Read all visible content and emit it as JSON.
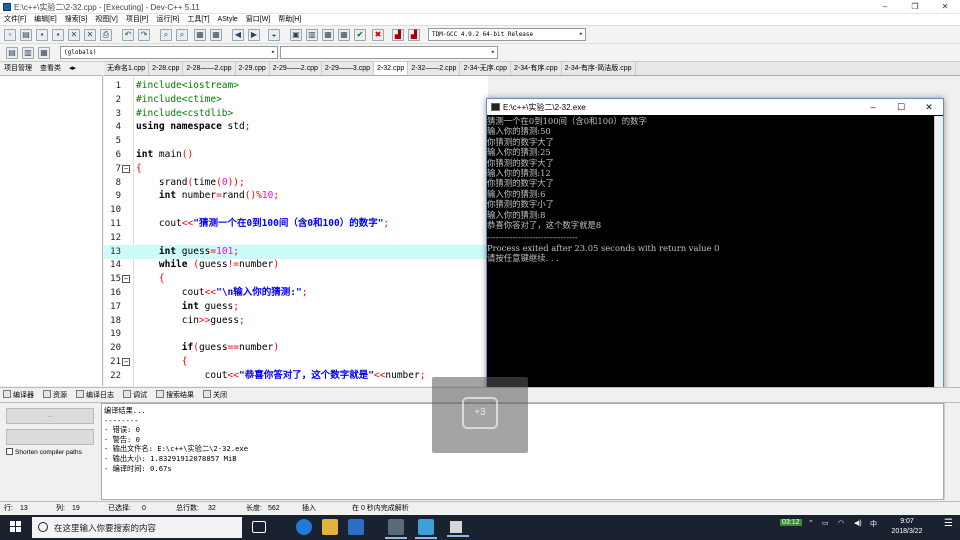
{
  "window": {
    "title": "E:\\c++\\实验二\\2-32.cpp - [Executing] - Dev-C++ 5.11",
    "minimize": "–",
    "restore": "❐",
    "close": "✕"
  },
  "menu": [
    "文件[F]",
    "编辑[E]",
    "搜索[S]",
    "视图[V]",
    "项目[P]",
    "运行[R]",
    "工具[T]",
    "AStyle",
    "窗口[W]",
    "帮助[H]"
  ],
  "toolbar": {
    "compiler": "TDM-GCC 4.9.2 64-bit Release",
    "scope": "(globals)"
  },
  "left_tabs": [
    "项目管理",
    "查看类"
  ],
  "file_tabs": [
    "无命名1.cpp",
    "2-28.cpp",
    "2-28——2.cpp",
    "2-29.cpp",
    "2-29——2.cpp",
    "2-29——3.cpp",
    "2-32.cpp",
    "2-32——2.cpp",
    "2-34-无序.cpp",
    "2-34-有序.cpp",
    "2-34-有序-简洁版.cpp"
  ],
  "active_file_tab": 6,
  "editor": {
    "highlight_line": 13,
    "lines": [
      {
        "n": "1",
        "fold": "",
        "parts": [
          [
            "pp",
            "#include<iostream>"
          ]
        ]
      },
      {
        "n": "2",
        "fold": "",
        "parts": [
          [
            "pp",
            "#include<ctime>"
          ]
        ]
      },
      {
        "n": "3",
        "fold": "",
        "parts": [
          [
            "pp",
            "#include<cstdlib>"
          ]
        ]
      },
      {
        "n": "4",
        "fold": "",
        "parts": [
          [
            "kw",
            "using namespace"
          ],
          [
            "plain",
            " std"
          ],
          [
            "sym",
            ";"
          ]
        ]
      },
      {
        "n": "5",
        "fold": "",
        "parts": []
      },
      {
        "n": "6",
        "fold": "",
        "parts": [
          [
            "kw",
            "int"
          ],
          [
            "plain",
            " main"
          ],
          [
            "sym",
            "()"
          ]
        ]
      },
      {
        "n": "7",
        "fold": "−",
        "parts": [
          [
            "sym",
            "{"
          ]
        ]
      },
      {
        "n": "8",
        "fold": "",
        "parts": [
          [
            "plain",
            "    srand"
          ],
          [
            "sym",
            "("
          ],
          [
            "plain",
            "time"
          ],
          [
            "sym",
            "("
          ],
          [
            "num",
            "0"
          ],
          [
            "sym",
            "));"
          ]
        ]
      },
      {
        "n": "9",
        "fold": "",
        "parts": [
          [
            "plain",
            "    "
          ],
          [
            "kw",
            "int"
          ],
          [
            "plain",
            " number"
          ],
          [
            "sym",
            "="
          ],
          [
            "plain",
            "rand"
          ],
          [
            "sym",
            "()%"
          ],
          [
            "num",
            "10"
          ],
          [
            "sym",
            ";"
          ]
        ]
      },
      {
        "n": "10",
        "fold": "",
        "parts": []
      },
      {
        "n": "11",
        "fold": "",
        "parts": [
          [
            "plain",
            "    cout"
          ],
          [
            "sym",
            "<<"
          ],
          [
            "str",
            "\"猜测一个在0到100间（含0和100）的数字\""
          ],
          [
            "sym",
            ";"
          ]
        ]
      },
      {
        "n": "12",
        "fold": "",
        "parts": []
      },
      {
        "n": "13",
        "fold": "",
        "parts": [
          [
            "plain",
            "    "
          ],
          [
            "kw",
            "int"
          ],
          [
            "plain",
            " guess"
          ],
          [
            "sym",
            "="
          ],
          [
            "num",
            "101"
          ],
          [
            "sym",
            ";"
          ]
        ]
      },
      {
        "n": "14",
        "fold": "",
        "parts": [
          [
            "plain",
            "    "
          ],
          [
            "kw",
            "while"
          ],
          [
            "plain",
            " "
          ],
          [
            "sym",
            "("
          ],
          [
            "plain",
            "guess"
          ],
          [
            "sym",
            "!="
          ],
          [
            "plain",
            "number"
          ],
          [
            "sym",
            ")"
          ]
        ]
      },
      {
        "n": "15",
        "fold": "−",
        "parts": [
          [
            "plain",
            "    "
          ],
          [
            "sym",
            "{"
          ]
        ]
      },
      {
        "n": "16",
        "fold": "",
        "parts": [
          [
            "plain",
            "        cout"
          ],
          [
            "sym",
            "<<"
          ],
          [
            "str",
            "\"\\n输入你的猜测:\""
          ],
          [
            "sym",
            ";"
          ]
        ]
      },
      {
        "n": "17",
        "fold": "",
        "parts": [
          [
            "plain",
            "        "
          ],
          [
            "kw",
            "int"
          ],
          [
            "plain",
            " guess"
          ],
          [
            "sym",
            ";"
          ]
        ]
      },
      {
        "n": "18",
        "fold": "",
        "parts": [
          [
            "plain",
            "        cin"
          ],
          [
            "sym",
            ">>"
          ],
          [
            "plain",
            "guess"
          ],
          [
            "sym",
            ";"
          ]
        ]
      },
      {
        "n": "19",
        "fold": "",
        "parts": []
      },
      {
        "n": "20",
        "fold": "",
        "parts": [
          [
            "plain",
            "        "
          ],
          [
            "kw",
            "if"
          ],
          [
            "sym",
            "("
          ],
          [
            "plain",
            "guess"
          ],
          [
            "sym",
            "=="
          ],
          [
            "plain",
            "number"
          ],
          [
            "sym",
            ")"
          ]
        ]
      },
      {
        "n": "21",
        "fold": "−",
        "parts": [
          [
            "plain",
            "        "
          ],
          [
            "sym",
            "{"
          ]
        ]
      },
      {
        "n": "22",
        "fold": "",
        "parts": [
          [
            "plain",
            "            cout"
          ],
          [
            "sym",
            "<<"
          ],
          [
            "str",
            "\"恭喜你答对了，这个数字就是\""
          ],
          [
            "sym",
            "<<"
          ],
          [
            "plain",
            "number"
          ],
          [
            "sym",
            ";"
          ]
        ]
      }
    ]
  },
  "console": {
    "title": "E:\\c++\\实验二\\2-32.exe",
    "lines": [
      "猜测一个在0到100间（含0和100）的数字",
      "输入你的猜测:50",
      "你猜测的数字大了",
      "输入你的猜测:25",
      "你猜测的数字大了",
      "输入你的猜测:12",
      "你猜测的数字大了",
      "输入你的猜测:6",
      "你猜测的数字小了",
      "输入你的猜测:8",
      "恭喜你答对了，这个数字就是8",
      "--------------------------------",
      "Process exited after 23.05 seconds with return value 0",
      "请按任意键继续. . ."
    ]
  },
  "bottom_tabs": [
    "编译器",
    "资源",
    "编译日志",
    "调试",
    "搜索结果",
    "关闭"
  ],
  "bottom_left": {
    "button1": "...",
    "button2": "",
    "shorten": "Shorten compiler paths"
  },
  "log": [
    "编译结果...",
    "--------",
    "- 错误: 0",
    "- 警告: 0",
    "- 输出文件名: E:\\c++\\实验二\\2-32.exe",
    "- 输出大小: 1.83291912078857 MiB",
    "- 编译时间: 0.67s"
  ],
  "status": {
    "row_label": "行:",
    "row": "13",
    "col_label": "列:",
    "col": "19",
    "sel_label": "已选择:",
    "sel": "0",
    "total_label": "总行数:",
    "total": "32",
    "len_label": "长度:",
    "len": "562",
    "mode": "插入",
    "parse": "在 0 秒内完成解析"
  },
  "overlay_icon": "+3",
  "taskbar": {
    "search_placeholder": "在这里输入你要搜索的内容",
    "tray_badge": "03:12",
    "ime": "中",
    "time": "9:07",
    "date": "2018/3/22"
  }
}
